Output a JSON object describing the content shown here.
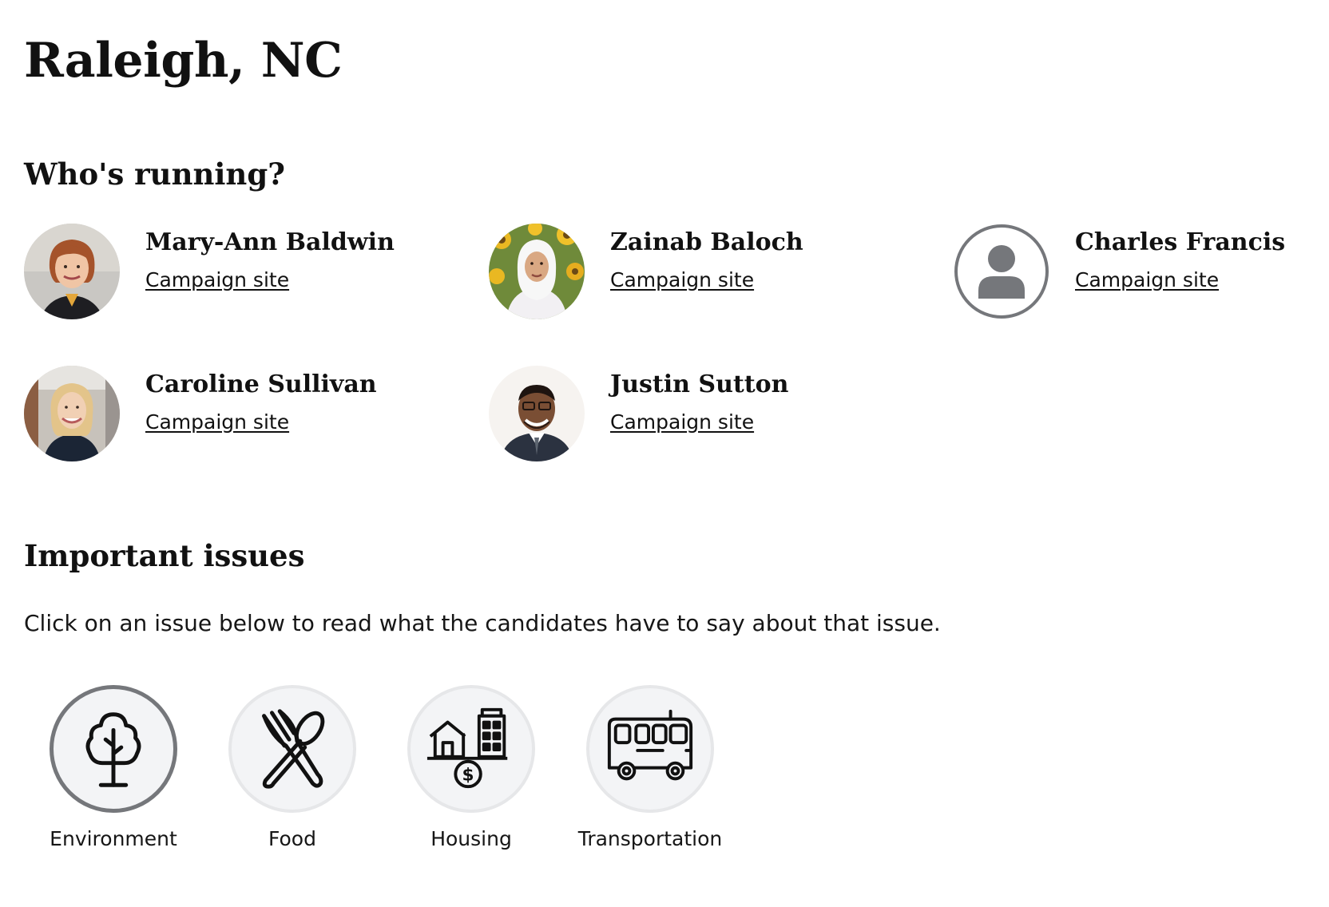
{
  "page": {
    "title": "Raleigh, NC"
  },
  "candidates_section": {
    "heading": "Who's running?",
    "candidates": [
      {
        "name": "Mary-Ann Baldwin",
        "link_label": "Campaign site"
      },
      {
        "name": "Zainab Baloch",
        "link_label": "Campaign site"
      },
      {
        "name": "Charles Francis",
        "link_label": "Campaign site"
      },
      {
        "name": "Caroline Sullivan",
        "link_label": "Campaign site"
      },
      {
        "name": "Justin Sutton",
        "link_label": "Campaign site"
      }
    ]
  },
  "issues_section": {
    "heading": "Important issues",
    "intro": "Click on an issue below to read what the candidates have to say about that issue.",
    "selected": "Environment",
    "issues": [
      {
        "label": "Environment",
        "icon": "tree-icon"
      },
      {
        "label": "Food",
        "icon": "fork-spoon-icon"
      },
      {
        "label": "Housing",
        "icon": "housing-icon"
      },
      {
        "label": "Transportation",
        "icon": "bus-icon"
      }
    ]
  },
  "colors": {
    "text": "#111111",
    "issue_circle_bg": "#f3f4f6",
    "issue_selected_border": "#75777b",
    "placeholder_avatar": "#75777b"
  }
}
